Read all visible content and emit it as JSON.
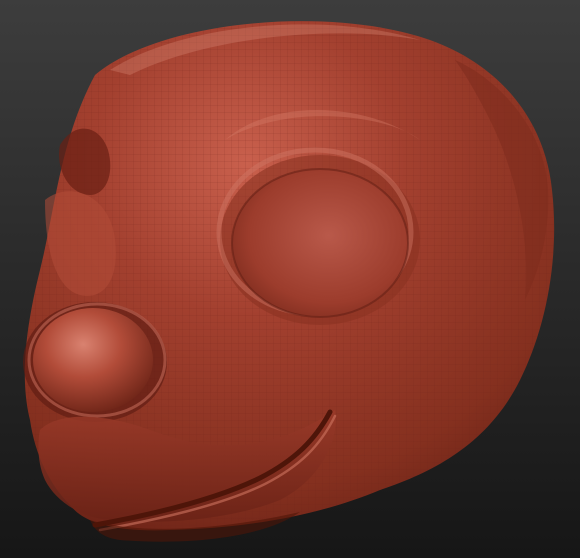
{
  "viewport": {
    "background_top": "#3d3d3d",
    "background_bottom": "#161616"
  },
  "model": {
    "subject": "head-sculpt",
    "material_base": "#a3402f",
    "material_highlight": "#d98270",
    "material_shadow": "#5e1c12",
    "wireframe_visible": true,
    "wireframe_color": "#6e2418"
  }
}
